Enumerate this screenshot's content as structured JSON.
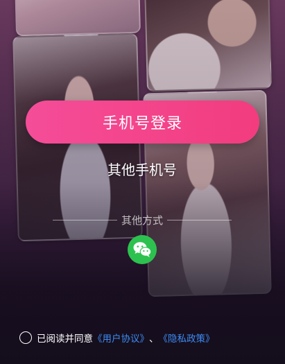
{
  "login": {
    "primary_button": "手机号登录",
    "secondary_button": "其他手机号",
    "other_methods_label": "其他方式"
  },
  "social": [
    {
      "name": "wechat",
      "icon": "wechat-icon",
      "color": "#2dc24f"
    }
  ],
  "agreement": {
    "prefix": "已阅读并同意",
    "user_agreement": "《用户协议》",
    "separator": "、",
    "privacy_policy": "《隐私政策》",
    "checked": false
  },
  "colors": {
    "primary": "#f54d99",
    "link": "#3d8cf5"
  }
}
